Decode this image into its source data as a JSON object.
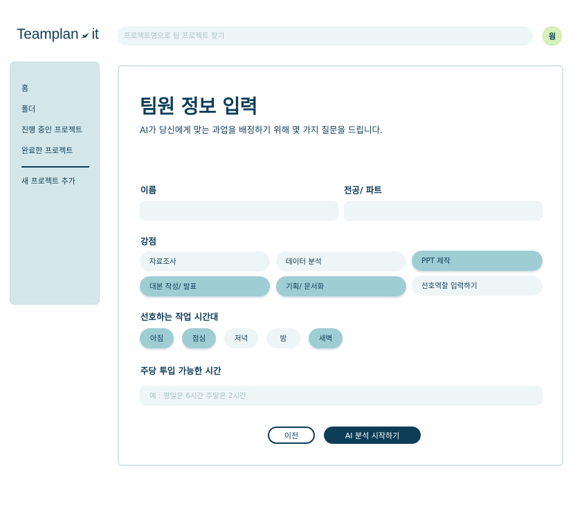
{
  "header": {
    "logo_left": "Teamplan",
    "logo_right": "it",
    "logo_icon": "bird-icon",
    "search_placeholder": "프로젝트명으로 팀 프로젝트 찾기",
    "avatar_text": "읨"
  },
  "sidebar": {
    "items": [
      {
        "label": "홈"
      },
      {
        "label": "폴더"
      },
      {
        "label": "진행 중인 프로젝트"
      },
      {
        "label": "완료한 프로젝트"
      }
    ],
    "add_label": "새 프로젝트 추가"
  },
  "form": {
    "title": "팀원 정보 입력",
    "subtitle": "AI가 당신에게 맞는 과업을 배정하기 위해 몇 가지 질문을 드립니다.",
    "name_label": "이름",
    "name_value": "",
    "major_label": "전공/ 파트",
    "major_value": "",
    "strengths_label": "강점",
    "strengths": [
      {
        "label": "자료조사",
        "selected": false
      },
      {
        "label": "데이터 분석",
        "selected": false
      },
      {
        "label": "PPT 제작",
        "selected": true
      },
      {
        "label": "대본 작성/ 발표",
        "selected": true
      },
      {
        "label": "기획/ 문서화",
        "selected": true
      },
      {
        "label": "선호역할 입력하기",
        "selected": false
      }
    ],
    "time_label": "선호하는 작업 시간대",
    "times": [
      {
        "label": "아침",
        "selected": true
      },
      {
        "label": "점심",
        "selected": true
      },
      {
        "label": "저녁",
        "selected": false
      },
      {
        "label": "밤",
        "selected": false
      },
      {
        "label": "새벽",
        "selected": true
      }
    ],
    "hours_label": "주당 투입 가능한 시간",
    "hours_placeholder": "예 : 평일은 6시간 주말은 2시간",
    "prev_button": "이전",
    "start_button": "AI 분석 시작하기"
  },
  "colors": {
    "primary": "#0d3d57",
    "sidebar_bg": "#d3e7ea",
    "field_bg": "#eef5f6",
    "chip_selected": "#9fcdd4",
    "avatar_bg": "#d7f2b9"
  }
}
